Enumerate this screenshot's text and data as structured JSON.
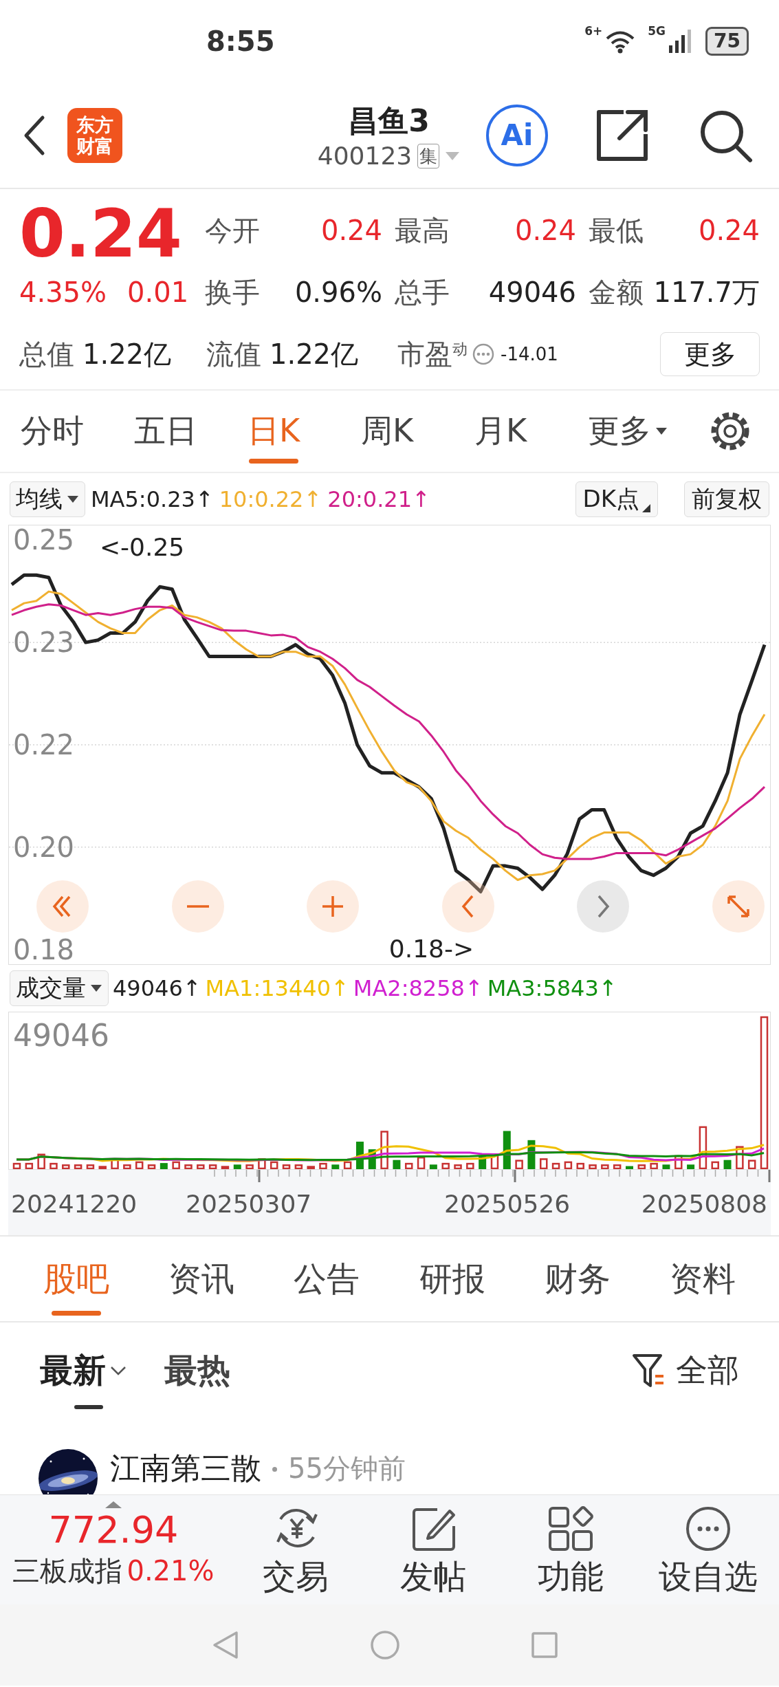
{
  "status_bar": {
    "time": "8:55",
    "wifi_badge": "6+",
    "network": "5G",
    "battery": "75"
  },
  "header": {
    "logo": "东方财富",
    "title": "昌鱼3",
    "code": "400123",
    "market_tag": "集",
    "ai_label": "Ai"
  },
  "quote": {
    "price": "0.24",
    "change_pct": "4.35%",
    "change": "0.01",
    "rising": true,
    "stats": [
      {
        "label": "今开",
        "value": "0.24",
        "color": "#e8262b"
      },
      {
        "label": "最高",
        "value": "0.24",
        "color": "#e8262b"
      },
      {
        "label": "最低",
        "value": "0.24",
        "color": "#e8262b"
      },
      {
        "label": "换手",
        "value": "0.96%",
        "color": "#222222"
      },
      {
        "label": "总手",
        "value": "49046",
        "color": "#222222"
      },
      {
        "label": "金额",
        "value": "117.7万",
        "color": "#222222"
      },
      {
        "label": "总值",
        "value": "1.22亿",
        "color": "#222222"
      },
      {
        "label": "流值",
        "value": "1.22亿",
        "color": "#222222"
      }
    ],
    "pe": {
      "label": "市盈$^{动}$",
      "value": "-14.01"
    },
    "more_button": "更多"
  },
  "period_tabs": [
    {
      "label": "分时",
      "selected": false,
      "dropdown": false
    },
    {
      "label": "五日",
      "selected": false,
      "dropdown": false
    },
    {
      "label": "日K",
      "selected": true,
      "dropdown": false
    },
    {
      "label": "周K",
      "selected": false,
      "dropdown": false
    },
    {
      "label": "月K",
      "selected": false,
      "dropdown": false
    },
    {
      "label": "更多",
      "selected": false,
      "dropdown": true
    }
  ],
  "chart_toolbar": {
    "ma_select": "均线",
    "ma_values": [
      {
        "text": "MA5:0.23↑",
        "color": "#222222"
      },
      {
        "text": "10:0.22↑",
        "color": "#f0b030"
      },
      {
        "text": "20:0.21↑",
        "color": "#d0208a"
      }
    ],
    "buttons": [
      {
        "label": "DK点",
        "dropdown": true
      },
      {
        "label": "前复权",
        "dropdown": false
      }
    ]
  },
  "chart": {
    "chart_data": {
      "type": "line",
      "grid": true,
      "ylim": [
        0.1775,
        0.2525
      ],
      "yticks": [
        {
          "value": 0.25,
          "label": "0.25"
        },
        {
          "value": 0.2325,
          "label": "0.23"
        },
        {
          "value": 0.215,
          "label": "0.22"
        },
        {
          "value": 0.1975,
          "label": "0.20"
        },
        {
          "value": 0.18,
          "label": "0.18"
        }
      ],
      "series": [
        {
          "color": "#222222",
          "values": [
            0.2424,
            0.244,
            0.244,
            0.2436,
            0.2388,
            0.236,
            0.2325,
            0.2329,
            0.2341,
            0.2341,
            0.236,
            0.2396,
            0.242,
            0.2416,
            0.2364,
            0.2333,
            0.2301,
            0.2301,
            0.2301,
            0.2301,
            0.2301,
            0.2301,
            0.2309,
            0.2321,
            0.2305,
            0.2297,
            0.2269,
            0.2221,
            0.215,
            0.2114,
            0.2102,
            0.2102,
            0.209,
            0.2078,
            0.2058,
            0.2007,
            0.1935,
            0.1919,
            0.1899,
            0.1943,
            0.1943,
            0.1939,
            0.1923,
            0.1903,
            0.1927,
            0.1963,
            0.2023,
            0.2039,
            0.2039,
            0.1991,
            0.1959,
            0.1935,
            0.1927,
            0.1939,
            0.1959,
            0.1999,
            0.2011,
            0.2054,
            0.2102,
            0.2202,
            0.2261,
            0.2321
          ]
        },
        {
          "color": "#f0b030",
          "values": [
            0.238,
            0.2392,
            0.2396,
            0.2412,
            0.2408,
            0.2392,
            0.2376,
            0.236,
            0.2349,
            0.2341,
            0.2341,
            0.2364,
            0.238,
            0.2388,
            0.2372,
            0.2368,
            0.236,
            0.2349,
            0.2329,
            0.2313,
            0.2301,
            0.2301,
            0.2309,
            0.2309,
            0.2301,
            0.2301,
            0.2285,
            0.2253,
            0.2213,
            0.2174,
            0.2138,
            0.2106,
            0.2086,
            0.2078,
            0.2054,
            0.2019,
            0.2003,
            0.1991,
            0.1971,
            0.1955,
            0.1935,
            0.1919,
            0.1927,
            0.1929,
            0.1935,
            0.1955,
            0.1975,
            0.1991,
            0.2,
            0.2,
            0.2,
            0.1987,
            0.1967,
            0.1947,
            0.1959,
            0.1963,
            0.1979,
            0.2011,
            0.2054,
            0.2126,
            0.2166,
            0.2202
          ]
        },
        {
          "color": "#d0208a",
          "values": [
            0.2372,
            0.238,
            0.2386,
            0.239,
            0.2388,
            0.238,
            0.2372,
            0.2375,
            0.2372,
            0.2376,
            0.2382,
            0.2386,
            0.2386,
            0.2384,
            0.2368,
            0.236,
            0.2353,
            0.2346,
            0.2345,
            0.2345,
            0.2341,
            0.2337,
            0.2338,
            0.2333,
            0.2317,
            0.2309,
            0.2297,
            0.2281,
            0.2261,
            0.2249,
            0.2233,
            0.2217,
            0.2202,
            0.219,
            0.2166,
            0.2138,
            0.2106,
            0.2082,
            0.2054,
            0.2031,
            0.2011,
            0.1999,
            0.1979,
            0.1963,
            0.1957,
            0.1955,
            0.1955,
            0.1955,
            0.1959,
            0.1965,
            0.1965,
            0.1965,
            0.1965,
            0.1961,
            0.1971,
            0.1983,
            0.1995,
            0.2007,
            0.2024,
            0.2042,
            0.2058,
            0.2078
          ]
        }
      ],
      "annotations": [
        "<-0.25",
        "0.18->"
      ]
    },
    "controls": [
      {
        "kind": "first",
        "disabled": false
      },
      {
        "kind": "zoom-out",
        "disabled": false
      },
      {
        "kind": "zoom-in",
        "disabled": false
      },
      {
        "kind": "prev",
        "disabled": false
      },
      {
        "kind": "next",
        "disabled": true
      },
      {
        "kind": "fullscreen",
        "disabled": false
      }
    ]
  },
  "volume": {
    "select": "成交量",
    "values": [
      {
        "text": "49046↑",
        "color": "#222222"
      },
      {
        "text": "MA1:13440↑",
        "color": "#f0c000"
      },
      {
        "text": "MA2:8258↑",
        "color": "#d020d0"
      },
      {
        "text": "MA3:5843↑",
        "color": "#109010"
      }
    ],
    "max_label": "49046",
    "dates": [
      "20241220",
      "20250307",
      "20250526",
      "20250808"
    ]
  },
  "info_tabs": [
    {
      "label": "股吧",
      "selected": true
    },
    {
      "label": "资讯",
      "selected": false
    },
    {
      "label": "公告",
      "selected": false
    },
    {
      "label": "研报",
      "selected": false
    },
    {
      "label": "财务",
      "selected": false
    },
    {
      "label": "资料",
      "selected": false
    }
  ],
  "feed": {
    "sort_tabs": [
      {
        "label": "最新",
        "selected": true,
        "dropdown": true
      },
      {
        "label": "最热",
        "selected": false,
        "dropdown": false
      }
    ],
    "filter": "全部",
    "post": {
      "author": "江南第三散",
      "time": "55分钟前"
    }
  },
  "bottom_bar": {
    "index_value": "772.94",
    "index_name": "三板成指",
    "index_change": "0.21%",
    "rising": true,
    "actions": [
      {
        "label": "交易",
        "kind": "trade"
      },
      {
        "label": "发帖",
        "kind": "post"
      },
      {
        "label": "功能",
        "kind": "apps"
      },
      {
        "label": "设自选",
        "kind": "more"
      }
    ]
  }
}
